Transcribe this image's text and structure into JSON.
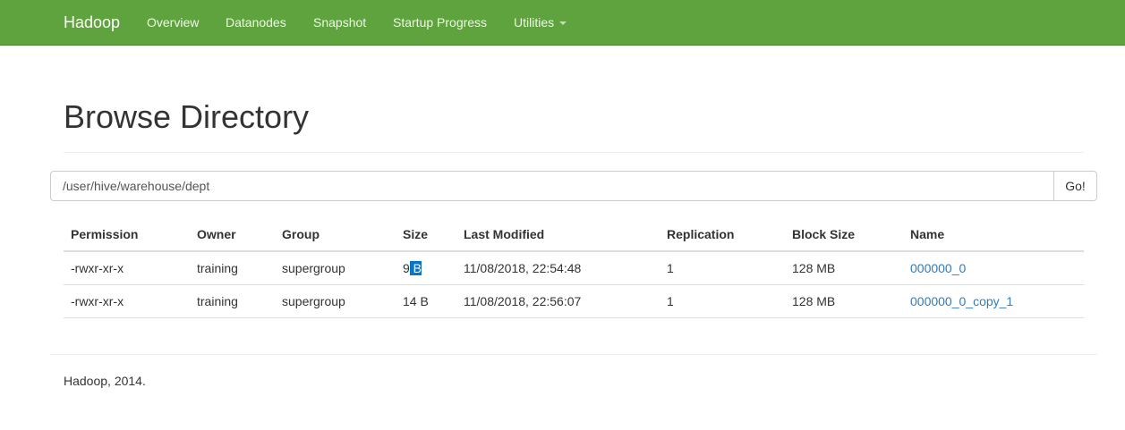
{
  "navbar": {
    "brand": "Hadoop",
    "items": [
      {
        "label": "Overview"
      },
      {
        "label": "Datanodes"
      },
      {
        "label": "Snapshot"
      },
      {
        "label": "Startup Progress"
      },
      {
        "label": "Utilities"
      }
    ]
  },
  "header": {
    "title": "Browse Directory"
  },
  "path_bar": {
    "value": "/user/hive/warehouse/dept",
    "go_label": "Go!"
  },
  "table": {
    "columns": [
      "Permission",
      "Owner",
      "Group",
      "Size",
      "Last Modified",
      "Replication",
      "Block Size",
      "Name"
    ],
    "rows": [
      {
        "permission": "-rwxr-xr-x",
        "owner": "training",
        "group": "supergroup",
        "size_num": "9",
        "size_unit": " B",
        "modified": "11/08/2018, 22:54:48",
        "replication": "1",
        "block_size": "128 MB",
        "name": "000000_0"
      },
      {
        "permission": "-rwxr-xr-x",
        "owner": "training",
        "group": "supergroup",
        "size": "14 B",
        "modified": "11/08/2018, 22:56:07",
        "replication": "1",
        "block_size": "128 MB",
        "name": "000000_0_copy_1"
      }
    ]
  },
  "footer": {
    "text": "Hadoop, 2014."
  },
  "colors": {
    "navbar_bg": "#5fa33e",
    "link": "#337ab7",
    "selection": "#0a74c6"
  }
}
